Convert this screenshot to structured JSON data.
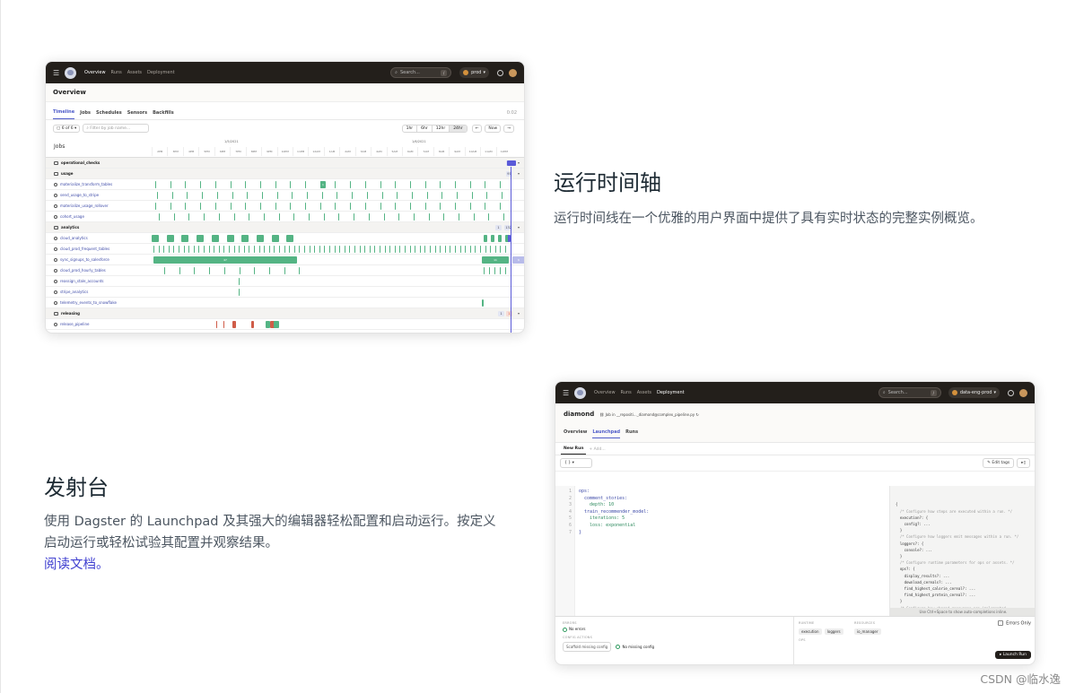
{
  "section1": {
    "title": "运行时间轴",
    "description": "运行时间线在一个优雅的用户界面中提供了具有实时状态的完整实例概览。"
  },
  "section2": {
    "title": "发射台",
    "description_line1": "使用 Dagster 的 Launchpad 及其强大的编辑器轻松配置和启动运行。按定义",
    "description_line2": "启动运行或轻松试验其配置并观察结果。",
    "link_text": "阅读文档。"
  },
  "watermark": "CSDN @临水逸",
  "timeline_app": {
    "nav": [
      "Overview",
      "Runs",
      "Assets",
      "Deployment"
    ],
    "search_placeholder": "Search...",
    "search_kbd": "/",
    "env": "prod",
    "avatar_letter": "J",
    "page_title": "Overview",
    "tabs": [
      "Timeline",
      "Jobs",
      "Schedules",
      "Sensors",
      "Backfills"
    ],
    "refresh_timer": "0:02",
    "filter_btn": "6 of 6",
    "filter_placeholder": "Filter by job name...",
    "ranges": [
      "1hr",
      "6hr",
      "12hr",
      "24hr"
    ],
    "now_btn": "Now",
    "jobs_header": "Jobs",
    "day1": "1/5/2021",
    "day2": "1/6/2021",
    "hours": [
      "2PM",
      "3PM",
      "4PM",
      "5PM",
      "6PM",
      "7PM",
      "8PM",
      "9PM",
      "10PM",
      "11PM",
      "12AM",
      "1AM",
      "2AM",
      "3AM",
      "4AM",
      "5AM",
      "6AM",
      "7AM",
      "8AM",
      "9AM",
      "10AM",
      "11AM",
      "12PM"
    ],
    "groups": [
      {
        "name": "operational_checks",
        "badges": [
          "2"
        ],
        "jobs": []
      },
      {
        "name": "usage",
        "badges": [
          "97"
        ],
        "jobs": [
          "materialize_transform_tables",
          "send_usage_to_stripe",
          "materialize_usage_rollover",
          "cohort_usage"
        ]
      },
      {
        "name": "analytics",
        "badges": [
          "1",
          "132"
        ],
        "jobs": [
          "cloud_analytics",
          "cloud_prod_frequent_tables",
          "sync_signups_to_salesforce",
          "cloud_prod_hourly_tables",
          "reassign_stale_accounts",
          "stripe_analytics",
          "telemetry_events_to_snowflake"
        ]
      },
      {
        "name": "releasing",
        "badges": [
          "1",
          "1"
        ],
        "jobs": [
          "release_pipeline"
        ]
      }
    ],
    "bar_labels": {
      "sync": "47",
      "sync_end": "11",
      "sync_now": "6",
      "usage_mid": "1"
    }
  },
  "launchpad_app": {
    "nav": [
      "Overview",
      "Runs",
      "Assets",
      "Deployment"
    ],
    "search_placeholder": "Search...",
    "search_kbd": "/",
    "env": "data-eng-prod",
    "avatar_letter": "J",
    "job_name": "diamond",
    "job_path": "Job in __repositi..._diamond@complex_pipeline.py",
    "tabs": [
      "Overview",
      "Launchpad",
      "Runs"
    ],
    "subtabs": [
      "New Run",
      "+ Add..."
    ],
    "preset": "{ } ▾",
    "edit_tags": "Edit tags",
    "code_lines": [
      {
        "n": "1",
        "t": "ops:"
      },
      {
        "n": "2",
        "t": "  comment_stories:"
      },
      {
        "n": "3",
        "t": "    depth: 10"
      },
      {
        "n": "4",
        "t": "  train_recommender_model:"
      },
      {
        "n": "5",
        "t": "    iterations: 5"
      },
      {
        "n": "6",
        "t": "    loss: exponential"
      },
      {
        "n": "7",
        "t": "}"
      }
    ],
    "schema_lines": [
      "{",
      "  /* Configure how steps are executed within a run. */",
      "  execution?: {",
      "    config?: ...",
      "  }",
      "  /* Configure how loggers emit messages within a run. */",
      "  loggers?: {",
      "    console?: ...",
      "  }",
      "  /* Configure runtime parameters for ops or assets. */",
      "  ops?: {",
      "    display_results?: ...",
      "    download_cereals?: ...",
      "    find_highest_calorie_cereal?: ...",
      "    find_highest_protein_cereal?: ...",
      "  }",
      "  /* Configure how shared resources are implemented",
      "     within a run. */"
    ],
    "hint": "Use Ctrl+Space to show auto-completions inline.",
    "errors_cap": "ERRORS",
    "no_errors": "No errors",
    "config_actions_cap": "CONFIG ACTIONS",
    "scaffold_btn": "Scaffold missing config",
    "no_missing": "No missing config",
    "runtime_cap": "RUNTIME",
    "runtime_chips": [
      "execution",
      "loggers"
    ],
    "resources_cap": "RESOURCES",
    "resources_chips": [
      "io_manager"
    ],
    "ops_cap": "OPS",
    "errors_only": "Errors Only",
    "launch_btn": "Launch Run"
  }
}
